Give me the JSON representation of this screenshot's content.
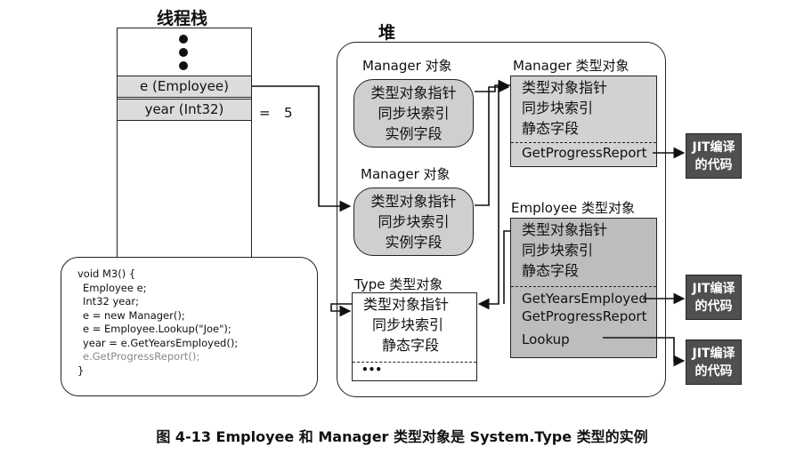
{
  "stack": {
    "title": "线程栈",
    "rows": [
      "e (Employee)",
      "year (Int32)"
    ],
    "year_equals": "=",
    "year_value": "5"
  },
  "heap": {
    "title": "堆",
    "manager_obj_1": {
      "label": "Manager 对象",
      "lines": [
        "类型对象指针",
        "同步块索引",
        "实例字段"
      ]
    },
    "manager_obj_2": {
      "label": "Manager 对象",
      "lines": [
        "类型对象指针",
        "同步块索引",
        "实例字段"
      ]
    },
    "type_type_obj": {
      "label": "Type 类型对象",
      "lines": [
        "类型对象指针",
        "同步块索引",
        "静态字段"
      ],
      "more": "•••"
    },
    "manager_type_obj": {
      "label": "Manager 类型对象",
      "lines": [
        "类型对象指针",
        "同步块索引",
        "静态字段"
      ],
      "methods": [
        "GetProgressReport"
      ]
    },
    "employee_type_obj": {
      "label": "Employee 类型对象",
      "lines": [
        "类型对象指针",
        "同步块索引",
        "静态字段"
      ],
      "methods": [
        "GetYearsEmployed",
        "GetProgressReport",
        "Lookup"
      ]
    }
  },
  "jit": {
    "line1": "JIT编译",
    "line2": "的代码"
  },
  "code": {
    "lines": [
      "void M3() {",
      "Employee e;",
      "Int32 year;",
      "e = new Manager();",
      "e = Employee.Lookup(\"Joe\");",
      "year = e.GetYearsEmployed();",
      "e.GetProgressReport();",
      "}"
    ]
  },
  "caption": "图 4-13    Employee 和 Manager 类型对象是 System.Type 类型的实例"
}
